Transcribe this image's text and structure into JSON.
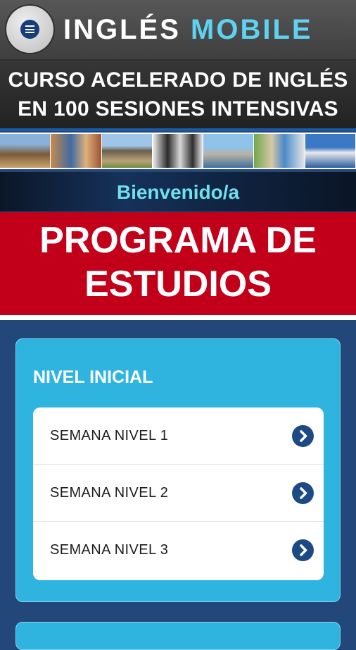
{
  "header": {
    "menu_icon": "hamburger-menu-icon",
    "logo_word1": "INGLÉS",
    "logo_word2": "MOBILE"
  },
  "course_title": {
    "line1": "CURSO ACELERADO DE INGLÉS",
    "line2": "EN 100 SESIONES INTENSIVAS"
  },
  "welcome_text": "Bienvenido/a",
  "program_title": {
    "line1": "PROGRAMA DE",
    "line2": "ESTUDIOS"
  },
  "levels": [
    {
      "title": "NIVEL INICIAL",
      "items": [
        {
          "label": "SEMANA NIVEL 1",
          "icon": "chevron-right-icon"
        },
        {
          "label": "SEMANA NIVEL 2",
          "icon": "chevron-right-icon"
        },
        {
          "label": "SEMANA NIVEL 3",
          "icon": "chevron-right-icon"
        }
      ]
    }
  ],
  "colors": {
    "background": "#24477a",
    "panel": "#2fb4e0",
    "program_banner": "#c2001a",
    "logo_accent": "#5fd2f2",
    "welcome_text": "#6ee0ee",
    "chevron": "#1c4a85"
  }
}
